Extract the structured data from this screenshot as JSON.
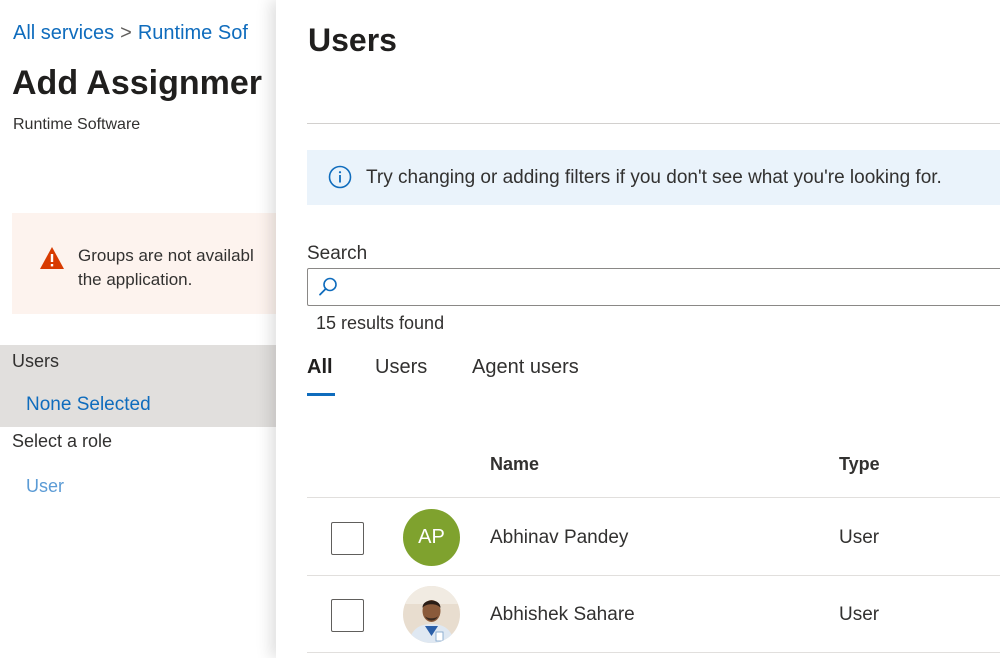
{
  "left": {
    "breadcrumb": {
      "root": "All services",
      "separator": ">",
      "current": "Runtime Sof"
    },
    "title": "Add Assignmer",
    "subtitle": "Runtime Software",
    "warning": {
      "icon": "warning-icon",
      "text_line1": "Groups are not availabl",
      "text_line2": "the application."
    },
    "users": {
      "label": "Users",
      "value": "None Selected"
    },
    "role": {
      "label": "Select a role",
      "value": "User"
    }
  },
  "blade": {
    "title": "Users",
    "info": {
      "icon": "info-icon",
      "text": "Try changing or adding filters if you don't see what you're looking for."
    },
    "search": {
      "label": "Search",
      "value": "",
      "placeholder": ""
    },
    "results_text": "15 results found",
    "tabs": [
      {
        "label": "All",
        "active": true
      },
      {
        "label": "Users",
        "active": false
      },
      {
        "label": "Agent users",
        "active": false
      }
    ],
    "table": {
      "columns": [
        "Name",
        "Type"
      ],
      "rows": [
        {
          "initials": "AP",
          "avatar_color": "#7fa22e",
          "name": "Abhinav Pandey",
          "type": "User"
        },
        {
          "initials": "",
          "avatar_photo": true,
          "name": "Abhishek Sahare",
          "type": "User"
        }
      ]
    }
  },
  "colors": {
    "link": "#0f6cbd",
    "warning_bg": "#fdf3ee",
    "warning_icon": "#d83b01",
    "info_bg": "#eaf3fb",
    "selected_bg": "#e1dfdd"
  }
}
